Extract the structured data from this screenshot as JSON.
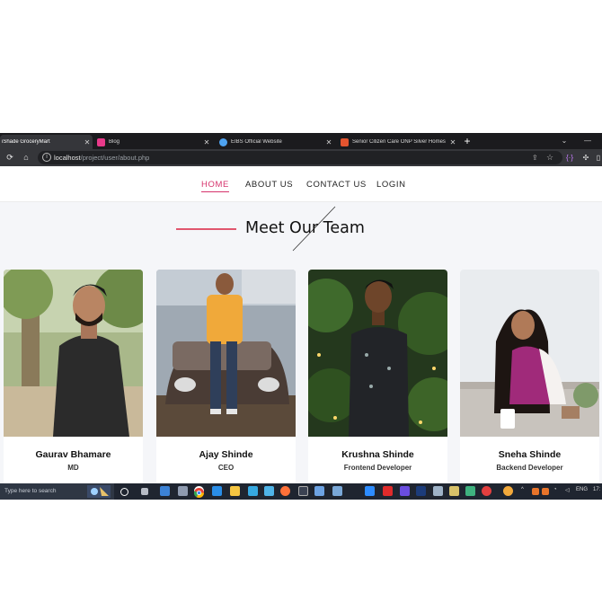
{
  "browser": {
    "tabs": [
      {
        "title": "iShade GroceryMart",
        "favicon_color": "#ffffff",
        "active": true
      },
      {
        "title": "Blog",
        "favicon_color": "#e93a8a",
        "active": false
      },
      {
        "title": "EIBS Official Website",
        "favicon_color": "#4ea3f1",
        "active": false
      },
      {
        "title": "Senior Citizen Care ONP Silver Homes",
        "favicon_color": "#e3542f",
        "active": false
      }
    ],
    "new_tab_label": "+",
    "url_host": "localhost",
    "url_path": "/project/user/about.php"
  },
  "nav": {
    "items": [
      {
        "label": "HOME",
        "active": true
      },
      {
        "label": "ABOUT US",
        "active": false
      },
      {
        "label": "CONTACT US",
        "active": false
      },
      {
        "label": "LOGIN",
        "active": false
      }
    ]
  },
  "section": {
    "title": "Meet Our Team",
    "accent": "#e0566e"
  },
  "team": [
    {
      "name": "Gaurav Bhamare",
      "role": "MD"
    },
    {
      "name": "Ajay Shinde",
      "role": "CEO"
    },
    {
      "name": "Krushna Shinde",
      "role": "Frontend Developer"
    },
    {
      "name": "Sneha Shinde",
      "role": "Backend Developer"
    }
  ],
  "taskbar": {
    "search_placeholder": "Type here to search",
    "language": "ENG",
    "time": "17:"
  }
}
